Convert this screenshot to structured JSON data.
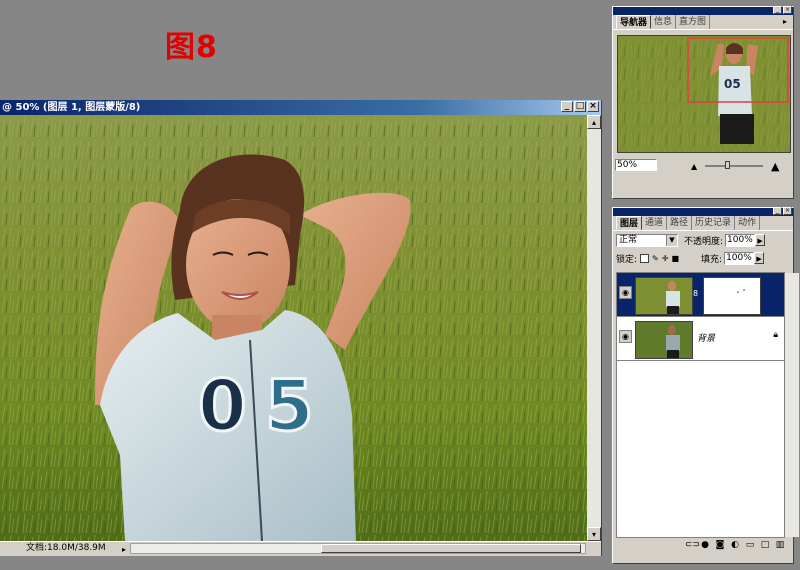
{
  "figure_label": "图8",
  "document": {
    "title": "@ 50% (图层 1, 图层蒙版/8)",
    "window_buttons": [
      "_",
      "□",
      "×"
    ],
    "status": "文档:18.0M/38.9M",
    "status_arrow": "▸",
    "scroll_arrows": {
      "left": "◂",
      "right": "▸",
      "up": "▴",
      "down": "▾"
    }
  },
  "navigator": {
    "tabs": [
      "导航器",
      "信息",
      "直方图"
    ],
    "active_tab": 0,
    "zoom": "50%",
    "menu_glyph": "▸"
  },
  "layers_palette": {
    "tabs": [
      "图层",
      "通道",
      "路径",
      "历史记录",
      "动作"
    ],
    "active_tab": 0,
    "blend_mode": "正常",
    "opacity_label": "不透明度:",
    "opacity": "100%",
    "lock_label": "锁定:",
    "fill_label": "填充:",
    "fill": "100%",
    "layers": [
      {
        "name": "",
        "selected": true,
        "has_mask": true
      },
      {
        "name": "背景",
        "selected": false,
        "locked": true
      }
    ],
    "bottom_icons": [
      "link-icon",
      "fx-icon",
      "mask-icon",
      "adjustment-icon",
      "folder-icon",
      "new-layer-icon",
      "trash-icon"
    ]
  },
  "colors": {
    "titlebar": "#0a246a",
    "workspace": "#868686",
    "figure_label": "#e40000",
    "nav_view_box": "#e04040"
  }
}
